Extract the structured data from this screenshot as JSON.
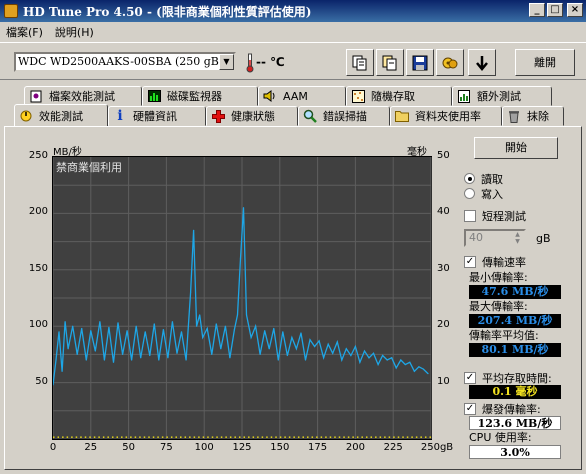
{
  "window": {
    "title": "HD Tune Pro 4.50 - (限非商業個利性質評估使用)",
    "controls": [
      "_",
      "□",
      "×"
    ]
  },
  "menu": [
    {
      "label": "檔案(F)"
    },
    {
      "label": "說明(H)"
    }
  ],
  "toolbar": {
    "drive": "WDC WD2500AAKS-00SBA    (250 gB)",
    "temperature": "-- ℃",
    "exit_label": "離開",
    "icons": [
      "copy-icon",
      "copy-text-icon",
      "save-icon",
      "options-icon",
      "download-icon"
    ]
  },
  "tabs_top": [
    {
      "label": "檔案效能測試",
      "icon": "file-benchmark-icon"
    },
    {
      "label": "磁碟監視器",
      "icon": "disk-monitor-icon"
    },
    {
      "label": "AAM",
      "icon": "speaker-icon"
    },
    {
      "label": "隨機存取",
      "icon": "random-access-icon"
    },
    {
      "label": "額外測試",
      "icon": "extra-tests-icon"
    }
  ],
  "tabs_bottom": [
    {
      "label": "效能測試",
      "icon": "benchmark-icon",
      "active": true
    },
    {
      "label": "硬體資訊",
      "icon": "info-icon"
    },
    {
      "label": "健康狀態",
      "icon": "health-cross-icon"
    },
    {
      "label": "錯誤掃描",
      "icon": "magnifier-icon"
    },
    {
      "label": "資料夾使用率",
      "icon": "folder-icon"
    },
    {
      "label": "抹除",
      "icon": "trash-icon"
    }
  ],
  "chart_overlay": {
    "left_unit": "MB/秒",
    "right_unit": "毫秒",
    "watermark": "禁商業個利用"
  },
  "side": {
    "start_label": "開始",
    "read_label": "讀取",
    "write_label": "寫入",
    "short_test_label": "短程測試",
    "short_value": "40",
    "short_unit": "gB",
    "transfer_label": "傳輸速率",
    "min_label": "最小傳輸率:",
    "min_value": "47.6 MB/秒",
    "max_label": "最大傳輸率:",
    "max_value": "207.4 MB/秒",
    "avg_label": "傳輸率平均值:",
    "avg_value": "80.1 MB/秒",
    "access_label": "平均存取時間:",
    "access_value": "0.1 毫秒",
    "burst_label": "爆發傳輸率:",
    "burst_value": "123.6 MB/秒",
    "cpu_label": "CPU 使用率:",
    "cpu_value": "3.0%"
  },
  "colors": {
    "transfer_line": "#1ea6e6",
    "access_dots": "#e8d81a",
    "readout_bg": "#000000",
    "readout_blue": "#2a8ee8",
    "readout_yellow": "#f0e020"
  },
  "chart_data": {
    "type": "line",
    "ylabel": "MB/秒",
    "y2label": "毫秒",
    "ylim": [
      0,
      250
    ],
    "y2lim": [
      0,
      50
    ],
    "xlim": [
      0,
      250
    ],
    "x_unit": "gB",
    "yticks": [
      50,
      100,
      150,
      200,
      250
    ],
    "y2ticks": [
      10,
      20,
      30,
      40,
      50
    ],
    "xticks": [
      0,
      25,
      50,
      75,
      100,
      125,
      150,
      175,
      200,
      225,
      250
    ],
    "grid": true,
    "series": [
      {
        "x": [
          0,
          2,
          4,
          6,
          8,
          10,
          13,
          16,
          19,
          22,
          25,
          28,
          31,
          34,
          37,
          40,
          43,
          46,
          49,
          52,
          55,
          58,
          61,
          64,
          67,
          70,
          73,
          76,
          79,
          82,
          85,
          88,
          91,
          93,
          95,
          97,
          99,
          102,
          105,
          108,
          111,
          114,
          117,
          120,
          122,
          124,
          126,
          128,
          131,
          134,
          137,
          140,
          143,
          146,
          149,
          152,
          155,
          158,
          161,
          164,
          167,
          170,
          173,
          176,
          179,
          182,
          185,
          188,
          191,
          194,
          197,
          200,
          203,
          206,
          209,
          212,
          215,
          218,
          221,
          224,
          227,
          230,
          233,
          236,
          239,
          242,
          245,
          248
        ],
        "values": [
          48,
          70,
          95,
          60,
          104,
          80,
          100,
          75,
          98,
          70,
          96,
          78,
          104,
          70,
          99,
          68,
          103,
          75,
          96,
          70,
          100,
          72,
          95,
          74,
          102,
          70,
          97,
          72,
          104,
          76,
          95,
          70,
          130,
          185,
          100,
          110,
          90,
          98,
          75,
          102,
          80,
          100,
          72,
          97,
          110,
          160,
          205,
          110,
          90,
          100,
          75,
          96,
          80,
          98,
          70,
          95,
          74,
          90,
          80,
          94,
          70,
          88,
          82,
          87,
          72,
          84,
          76,
          86,
          70,
          80,
          74,
          82,
          68,
          78,
          72,
          76,
          66,
          74,
          70,
          72,
          63,
          70,
          66,
          68,
          60,
          64,
          62,
          58
        ]
      }
    ],
    "access_time": {
      "x": [
        0,
        250
      ],
      "values": [
        0.1,
        0.1
      ]
    }
  }
}
